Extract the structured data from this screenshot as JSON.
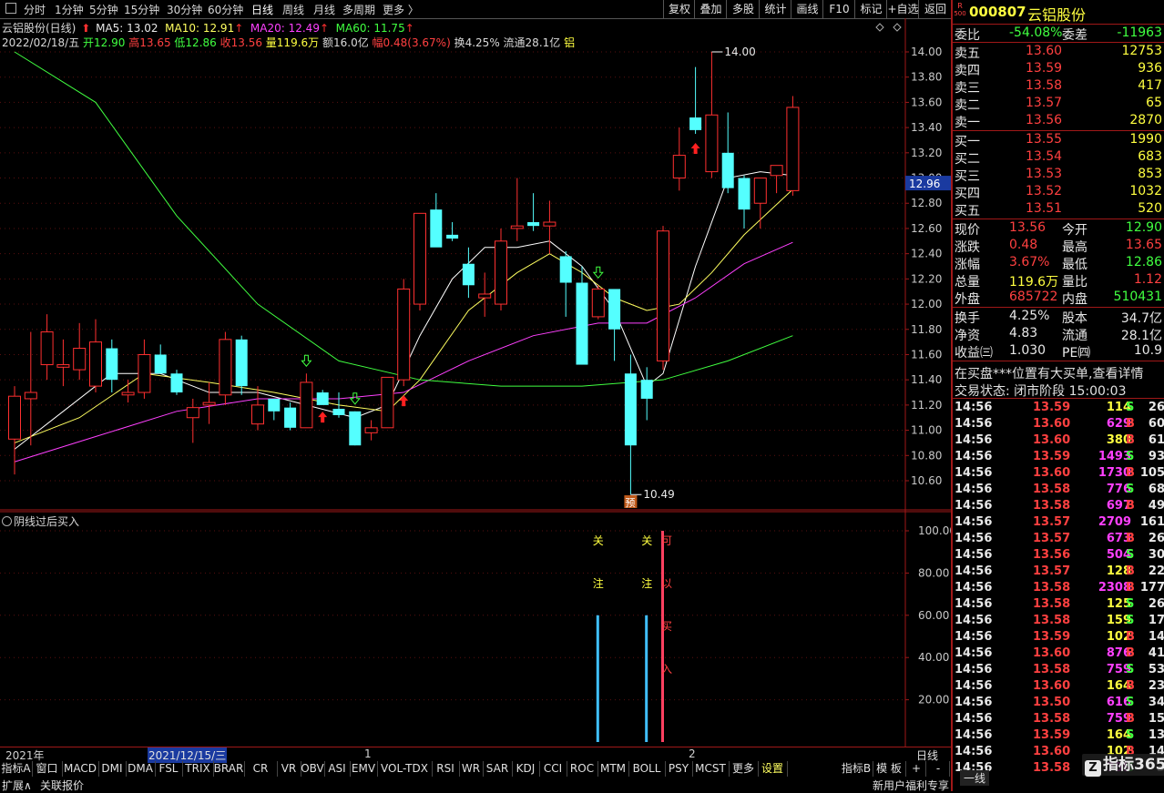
{
  "toolbar": {
    "periods": [
      "分时",
      "1分钟",
      "5分钟",
      "15分钟",
      "30分钟",
      "60分钟",
      "日线",
      "周线",
      "月线",
      "多周期",
      "更多 〉"
    ],
    "right_buttons": [
      "复权",
      "叠加",
      "多股",
      "统计",
      "画线",
      "F10",
      "标记",
      "+自选",
      "返回"
    ]
  },
  "header": {
    "stock": "云铝股份(日线)",
    "ma5": "MA5: 13.02",
    "ma10": "MA10: 12.91",
    "ma20": "MA20: 12.49",
    "ma60": "MA60: 11.75",
    "date": "2022/02/18/五",
    "open": "开12.90",
    "high": "高13.65",
    "low": "低12.86",
    "close": "收13.56",
    "volume": "量119.6万",
    "amount": "额16.0亿",
    "amplitude": "幅0.48(3.67%)",
    "turnover": "换4.25%",
    "float": "流通28.1亿",
    "sector": "铝"
  },
  "price_axis": [
    "14.00",
    "13.80",
    "13.60",
    "13.40",
    "13.20",
    "13.00",
    "12.80",
    "12.60",
    "12.40",
    "12.20",
    "12.00",
    "11.80",
    "11.60",
    "11.40",
    "11.20",
    "11.00",
    "10.80",
    "10.60"
  ],
  "current_price_tag": "12.96",
  "high_marker": "14.00",
  "low_marker": "10.49",
  "pre_tag": "预",
  "chart_data": {
    "type": "candlestick",
    "ylim": [
      10.45,
      14.2
    ],
    "candles": [
      {
        "o": 10.93,
        "h": 11.35,
        "l": 10.65,
        "c": 11.27
      },
      {
        "o": 11.25,
        "h": 11.78,
        "l": 10.88,
        "c": 11.3
      },
      {
        "o": 11.52,
        "h": 11.92,
        "l": 11.4,
        "c": 11.78
      },
      {
        "o": 11.5,
        "h": 11.72,
        "l": 11.35,
        "c": 11.52
      },
      {
        "o": 11.48,
        "h": 11.85,
        "l": 11.4,
        "c": 11.65
      },
      {
        "o": 11.35,
        "h": 11.88,
        "l": 11.3,
        "c": 11.7
      },
      {
        "o": 11.65,
        "h": 11.72,
        "l": 11.3,
        "c": 11.4
      },
      {
        "o": 11.28,
        "h": 11.4,
        "l": 11.22,
        "c": 11.3
      },
      {
        "o": 11.3,
        "h": 11.72,
        "l": 11.25,
        "c": 11.6
      },
      {
        "o": 11.6,
        "h": 11.68,
        "l": 11.45,
        "c": 11.45
      },
      {
        "o": 11.45,
        "h": 11.48,
        "l": 11.28,
        "c": 11.3
      },
      {
        "o": 11.1,
        "h": 11.25,
        "l": 10.9,
        "c": 11.18
      },
      {
        "o": 11.2,
        "h": 11.38,
        "l": 11.05,
        "c": 11.22
      },
      {
        "o": 11.28,
        "h": 11.78,
        "l": 11.2,
        "c": 11.72
      },
      {
        "o": 11.72,
        "h": 11.75,
        "l": 11.28,
        "c": 11.35
      },
      {
        "o": 11.05,
        "h": 11.35,
        "l": 11.0,
        "c": 11.2
      },
      {
        "o": 11.25,
        "h": 11.25,
        "l": 11.08,
        "c": 11.15
      },
      {
        "o": 11.18,
        "h": 11.22,
        "l": 11.0,
        "c": 11.02
      },
      {
        "o": 11.02,
        "h": 11.45,
        "l": 11.02,
        "c": 11.38
      },
      {
        "o": 11.3,
        "h": 11.32,
        "l": 11.22,
        "c": 11.2
      },
      {
        "o": 11.17,
        "h": 11.3,
        "l": 11.1,
        "c": 11.12
      },
      {
        "o": 11.15,
        "h": 11.15,
        "l": 10.88,
        "c": 10.88
      },
      {
        "o": 10.98,
        "h": 11.08,
        "l": 10.92,
        "c": 11.02
      },
      {
        "o": 11.02,
        "h": 11.42,
        "l": 11.02,
        "c": 11.42
      },
      {
        "o": 11.4,
        "h": 12.2,
        "l": 11.35,
        "c": 12.12
      },
      {
        "o": 12.0,
        "h": 12.58,
        "l": 11.95,
        "c": 12.72
      },
      {
        "o": 12.75,
        "h": 12.88,
        "l": 12.55,
        "c": 12.45
      },
      {
        "o": 12.55,
        "h": 12.65,
        "l": 12.5,
        "c": 12.52
      },
      {
        "o": 12.32,
        "h": 12.45,
        "l": 12.05,
        "c": 12.15
      },
      {
        "o": 12.05,
        "h": 12.25,
        "l": 11.9,
        "c": 12.08
      },
      {
        "o": 12.0,
        "h": 12.6,
        "l": 11.95,
        "c": 12.5
      },
      {
        "o": 12.6,
        "h": 13.0,
        "l": 12.5,
        "c": 12.62
      },
      {
        "o": 12.65,
        "h": 12.88,
        "l": 12.58,
        "c": 12.62
      },
      {
        "o": 12.62,
        "h": 12.82,
        "l": 12.4,
        "c": 12.65
      },
      {
        "o": 12.38,
        "h": 12.42,
        "l": 11.9,
        "c": 12.17
      },
      {
        "o": 12.17,
        "h": 12.3,
        "l": 11.52,
        "c": 11.52
      },
      {
        "o": 11.9,
        "h": 12.15,
        "l": 11.88,
        "c": 12.12
      },
      {
        "o": 12.12,
        "h": 12.1,
        "l": 11.55,
        "c": 11.8
      },
      {
        "o": 11.45,
        "h": 11.6,
        "l": 10.49,
        "c": 10.88
      },
      {
        "o": 11.4,
        "h": 11.5,
        "l": 11.08,
        "c": 11.25
      },
      {
        "o": 11.55,
        "h": 12.62,
        "l": 11.48,
        "c": 12.58
      },
      {
        "o": 13.0,
        "h": 13.4,
        "l": 12.9,
        "c": 13.18
      },
      {
        "o": 13.48,
        "h": 13.88,
        "l": 13.35,
        "c": 13.38
      },
      {
        "o": 13.05,
        "h": 14.0,
        "l": 13.0,
        "c": 13.5
      },
      {
        "o": 13.2,
        "h": 13.52,
        "l": 12.88,
        "c": 12.92
      },
      {
        "o": 13.0,
        "h": 13.02,
        "l": 12.6,
        "c": 12.75
      },
      {
        "o": 12.8,
        "h": 12.88,
        "l": 12.6,
        "c": 13.0
      },
      {
        "o": 13.02,
        "h": 13.02,
        "l": 12.88,
        "c": 13.1
      },
      {
        "o": 12.9,
        "h": 13.65,
        "l": 12.86,
        "c": 13.56
      }
    ],
    "ma_series": [
      {
        "name": "MA5",
        "color": "#ffffff",
        "points": [
          [
            0,
            10.85
          ],
          [
            3,
            11.15
          ],
          [
            6,
            11.45
          ],
          [
            9,
            11.45
          ],
          [
            12,
            11.3
          ],
          [
            15,
            11.3
          ],
          [
            18,
            11.2
          ],
          [
            21,
            11.1
          ],
          [
            23,
            11.2
          ],
          [
            25,
            11.75
          ],
          [
            27,
            12.2
          ],
          [
            29,
            12.45
          ],
          [
            31,
            12.45
          ],
          [
            33,
            12.5
          ],
          [
            35,
            12.3
          ],
          [
            37,
            11.95
          ],
          [
            39,
            11.35
          ],
          [
            40,
            11.45
          ],
          [
            42,
            12.3
          ],
          [
            44,
            13.0
          ],
          [
            46,
            13.05
          ],
          [
            48,
            13.02
          ]
        ]
      },
      {
        "name": "MA10",
        "color": "#ffff60",
        "points": [
          [
            0,
            10.9
          ],
          [
            4,
            11.1
          ],
          [
            8,
            11.45
          ],
          [
            12,
            11.38
          ],
          [
            16,
            11.3
          ],
          [
            20,
            11.2
          ],
          [
            23,
            11.15
          ],
          [
            25,
            11.4
          ],
          [
            28,
            11.95
          ],
          [
            31,
            12.25
          ],
          [
            33,
            12.4
          ],
          [
            35,
            12.25
          ],
          [
            37,
            12.05
          ],
          [
            39,
            11.95
          ],
          [
            41,
            12.0
          ],
          [
            43,
            12.25
          ],
          [
            45,
            12.55
          ],
          [
            48,
            12.91
          ]
        ]
      },
      {
        "name": "MA20",
        "color": "#ff40ff",
        "points": [
          [
            0,
            10.75
          ],
          [
            5,
            10.95
          ],
          [
            10,
            11.15
          ],
          [
            15,
            11.25
          ],
          [
            20,
            11.25
          ],
          [
            24,
            11.3
          ],
          [
            28,
            11.55
          ],
          [
            32,
            11.75
          ],
          [
            36,
            11.85
          ],
          [
            39,
            11.85
          ],
          [
            42,
            12.05
          ],
          [
            45,
            12.32
          ],
          [
            48,
            12.49
          ]
        ]
      },
      {
        "name": "MA60",
        "color": "#40ff40",
        "points": [
          [
            0,
            14.0
          ],
          [
            5,
            13.6
          ],
          [
            10,
            12.7
          ],
          [
            15,
            12.0
          ],
          [
            20,
            11.55
          ],
          [
            25,
            11.4
          ],
          [
            30,
            11.35
          ],
          [
            35,
            11.35
          ],
          [
            40,
            11.4
          ],
          [
            44,
            11.55
          ],
          [
            48,
            11.75
          ]
        ]
      }
    ],
    "buy_arrows": [
      19,
      24,
      42
    ],
    "sell_arrows": [
      18,
      21,
      36
    ]
  },
  "sub_chart": {
    "title": "阴线过后买入",
    "axis": [
      "100.00",
      "80.00",
      "60.00",
      "40.00",
      "20.00"
    ],
    "labels": [
      {
        "bar": 36,
        "chars": [
          "关",
          "注"
        ],
        "color": "#ffff40"
      },
      {
        "bar": 39,
        "chars": [
          "关",
          "注"
        ],
        "color": "#ffff40"
      },
      {
        "bar": 40,
        "chars": [
          "可",
          "以",
          "买",
          "入"
        ],
        "color": "#ff4040"
      }
    ],
    "bars": [
      {
        "bar": 36,
        "value": 60,
        "color": "#40c0ff"
      },
      {
        "bar": 39,
        "value": 60,
        "color": "#40c0ff"
      },
      {
        "bar": 40,
        "value": 100,
        "color": "#ff4060"
      }
    ]
  },
  "date_axis": {
    "year": "2021年",
    "cursor": "2021/12/15/三",
    "m1": "1",
    "m2": "2",
    "label": "日线"
  },
  "indicator_tabs": [
    "指标A",
    "窗口",
    "MACD",
    "DMI",
    "DMA",
    "FSL",
    "TRIX",
    "BRAR",
    "CR",
    "VR",
    "OBV",
    "ASI",
    "EMV",
    "VOL-TDX",
    "RSI",
    "WR",
    "SAR",
    "KDJ",
    "CCI",
    "ROC",
    "MTM",
    "BOLL",
    "PSY",
    "MCST",
    "更多",
    "设置"
  ],
  "indicator_right": [
    "指标B",
    "模 板",
    "+",
    "-"
  ],
  "bottom_left": [
    "扩展∧",
    "关联报价"
  ],
  "bottom_right": "新用户福利专享",
  "bottom_right2": "一线",
  "watermark": "指标365",
  "quote": {
    "code": "000807",
    "name": "云铝股份",
    "tag1": "R",
    "tag2": "500",
    "weibi_label": "委比",
    "weibi": "-54.08%",
    "weicha_label": "委差",
    "weicha": "-11963",
    "asks": [
      {
        "label": "卖五",
        "price": "13.60",
        "vol": "12753"
      },
      {
        "label": "卖四",
        "price": "13.59",
        "vol": "936"
      },
      {
        "label": "卖三",
        "price": "13.58",
        "vol": "417"
      },
      {
        "label": "卖二",
        "price": "13.57",
        "vol": "65"
      },
      {
        "label": "卖一",
        "price": "13.56",
        "vol": "2870"
      }
    ],
    "bids": [
      {
        "label": "买一",
        "price": "13.55",
        "vol": "1990"
      },
      {
        "label": "买二",
        "price": "13.54",
        "vol": "683"
      },
      {
        "label": "买三",
        "price": "13.53",
        "vol": "853"
      },
      {
        "label": "买四",
        "price": "13.52",
        "vol": "1032"
      },
      {
        "label": "买五",
        "price": "13.51",
        "vol": "520"
      }
    ],
    "stats1": [
      {
        "l1": "现价",
        "v1": "13.56",
        "c1": "red",
        "l2": "今开",
        "v2": "12.90",
        "c2": "grn"
      },
      {
        "l1": "涨跌",
        "v1": "0.48",
        "c1": "red",
        "l2": "最高",
        "v2": "13.65",
        "c2": "red"
      },
      {
        "l1": "涨幅",
        "v1": "3.67%",
        "c1": "red",
        "l2": "最低",
        "v2": "12.86",
        "c2": "grn"
      },
      {
        "l1": "总量",
        "v1": "119.6万",
        "c1": "yel",
        "l2": "量比",
        "v2": "1.12",
        "c2": "red"
      },
      {
        "l1": "外盘",
        "v1": "685722",
        "c1": "red",
        "l2": "内盘",
        "v2": "510431",
        "c2": "grn"
      }
    ],
    "stats2": [
      {
        "l1": "换手",
        "v1": "4.25%",
        "l2": "股本",
        "v2": "34.7亿"
      },
      {
        "l1": "净资",
        "v1": "4.83",
        "l2": "流通",
        "v2": "28.1亿"
      },
      {
        "l1": "收益㈢",
        "v1": "1.030",
        "l2": "PE㈣",
        "v2": "10.9"
      }
    ],
    "notice": "在买盘***位置有大买单,查看详情",
    "trade_state": "交易状态: 闭市阶段 15:00:03",
    "ticks": [
      {
        "t": "14:56",
        "p": "13.59",
        "pc": "red",
        "v": "114",
        "vc": "yel",
        "d": "S",
        "dc": "grn",
        "n": "26"
      },
      {
        "t": "14:56",
        "p": "13.60",
        "pc": "red",
        "v": "629",
        "vc": "mag",
        "d": "B",
        "dc": "red",
        "n": "60"
      },
      {
        "t": "14:56",
        "p": "13.60",
        "pc": "red",
        "v": "380",
        "vc": "yel",
        "d": "B",
        "dc": "red",
        "n": "61"
      },
      {
        "t": "14:56",
        "p": "13.59",
        "pc": "red",
        "v": "1493",
        "vc": "mag",
        "d": "S",
        "dc": "grn",
        "n": "93"
      },
      {
        "t": "14:56",
        "p": "13.60",
        "pc": "red",
        "v": "1730",
        "vc": "mag",
        "d": "B",
        "dc": "red",
        "n": "105"
      },
      {
        "t": "14:56",
        "p": "13.58",
        "pc": "red",
        "v": "776",
        "vc": "mag",
        "d": "S",
        "dc": "grn",
        "n": "68"
      },
      {
        "t": "14:56",
        "p": "13.58",
        "pc": "red",
        "v": "697",
        "vc": "mag",
        "d": "B",
        "dc": "red",
        "n": "49"
      },
      {
        "t": "14:56",
        "p": "13.57",
        "pc": "red",
        "v": "2709",
        "vc": "mag",
        "d": "",
        "dc": "red",
        "n": "161"
      },
      {
        "t": "14:56",
        "p": "13.57",
        "pc": "red",
        "v": "673",
        "vc": "mag",
        "d": "B",
        "dc": "red",
        "n": "26"
      },
      {
        "t": "14:56",
        "p": "13.56",
        "pc": "red",
        "v": "504",
        "vc": "mag",
        "d": "S",
        "dc": "grn",
        "n": "30"
      },
      {
        "t": "14:56",
        "p": "13.57",
        "pc": "red",
        "v": "128",
        "vc": "yel",
        "d": "B",
        "dc": "red",
        "n": "22"
      },
      {
        "t": "14:56",
        "p": "13.58",
        "pc": "red",
        "v": "2308",
        "vc": "mag",
        "d": "B",
        "dc": "red",
        "n": "177"
      },
      {
        "t": "14:56",
        "p": "13.58",
        "pc": "red",
        "v": "125",
        "vc": "yel",
        "d": "S",
        "dc": "grn",
        "n": "26"
      },
      {
        "t": "14:56",
        "p": "13.58",
        "pc": "red",
        "v": "159",
        "vc": "yel",
        "d": "S",
        "dc": "grn",
        "n": "17"
      },
      {
        "t": "14:56",
        "p": "13.59",
        "pc": "red",
        "v": "102",
        "vc": "yel",
        "d": "B",
        "dc": "red",
        "n": "14"
      },
      {
        "t": "14:56",
        "p": "13.60",
        "pc": "red",
        "v": "876",
        "vc": "mag",
        "d": "B",
        "dc": "red",
        "n": "41"
      },
      {
        "t": "14:56",
        "p": "13.58",
        "pc": "red",
        "v": "759",
        "vc": "mag",
        "d": "S",
        "dc": "grn",
        "n": "53"
      },
      {
        "t": "14:56",
        "p": "13.60",
        "pc": "red",
        "v": "164",
        "vc": "yel",
        "d": "B",
        "dc": "red",
        "n": "23"
      },
      {
        "t": "14:56",
        "p": "13.50",
        "pc": "red",
        "v": "616",
        "vc": "mag",
        "d": "S",
        "dc": "grn",
        "n": "34"
      },
      {
        "t": "14:56",
        "p": "13.58",
        "pc": "red",
        "v": "759",
        "vc": "mag",
        "d": "B",
        "dc": "red",
        "n": "15"
      },
      {
        "t": "14:56",
        "p": "13.59",
        "pc": "red",
        "v": "164",
        "vc": "yel",
        "d": "S",
        "dc": "grn",
        "n": "13"
      },
      {
        "t": "14:56",
        "p": "13.60",
        "pc": "red",
        "v": "102",
        "vc": "yel",
        "d": "B",
        "dc": "red",
        "n": "14"
      },
      {
        "t": "14:56",
        "p": "13.58",
        "pc": "red",
        "v": "759",
        "vc": "mag",
        "d": "S",
        "dc": "grn",
        "n": "3"
      }
    ]
  }
}
